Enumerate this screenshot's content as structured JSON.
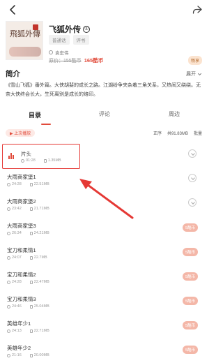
{
  "book": {
    "title": "飞狐外传",
    "badge": "①",
    "cover_text": "飛狐外傳",
    "tags": [
      "普通话",
      "评书"
    ],
    "author": "袁宏伟",
    "original_price": "原价：155酷币",
    "sale_price": "165酷币",
    "vip_tag": "畅享"
  },
  "intro": {
    "heading": "简介",
    "expand_label": "展开",
    "text": "《雪山飞狐》番外篇。大侠胡斐的成长之路。江湖纷争夹杂着三角关系，又热闹又绕绕。无奈大侠终会长大，生死离别是成长的烙印。"
  },
  "tabs": [
    {
      "label": "目录"
    },
    {
      "label": "评论"
    },
    {
      "label": "周边"
    }
  ],
  "toolbar": {
    "play_label": "▶ 上次播放",
    "sort_label": "正序",
    "total_label": "共91.83MB",
    "batch_label": "批量"
  },
  "chapters": [
    {
      "title": "片头",
      "duration": "01:28",
      "size": "1.35MB",
      "price": ""
    },
    {
      "title": "大雨商家堡1",
      "duration": "24:28",
      "size": "22.51MB",
      "price": ""
    },
    {
      "title": "大雨商家堡2",
      "duration": "23:42",
      "size": "21.71MB",
      "price": ""
    },
    {
      "title": "大雨商家堡3",
      "duration": "26:34",
      "size": "24.21MB",
      "price": "5酷币"
    },
    {
      "title": "宝刀和柔情1",
      "duration": "24:07",
      "size": "22.7MB",
      "price": "5酷币"
    },
    {
      "title": "宝刀和柔情2",
      "duration": "24:28",
      "size": "22.47MB",
      "price": "5酷币"
    },
    {
      "title": "宝刀和柔情3",
      "duration": "24:46",
      "size": "25.04MB",
      "price": "5酷币"
    },
    {
      "title": "英雄年少1",
      "duration": "24:13",
      "size": "22.71MB",
      "price": "5酷币"
    },
    {
      "title": "英雄年少2",
      "duration": "21:16",
      "size": "20.00MB",
      "price": "5酷币"
    }
  ],
  "colors": {
    "accent": "#e14b3b",
    "highlight_box": "#e53935"
  },
  "icons": {
    "back": "chevron-left-icon",
    "share": "share-icon",
    "download": "download-icon",
    "playing": "equalizer-icon"
  }
}
